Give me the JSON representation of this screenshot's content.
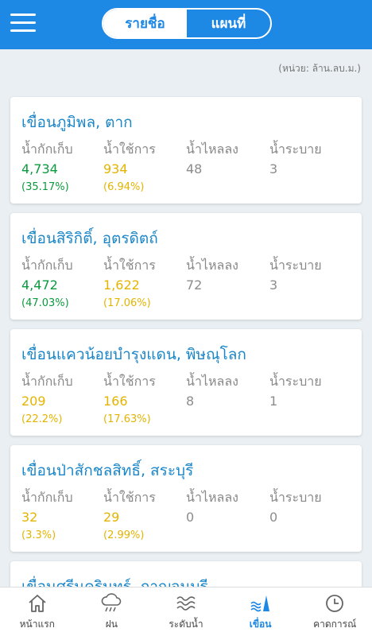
{
  "header": {
    "tabs": [
      "รายชื่อ",
      "แผนที่"
    ],
    "active_tab": "รายชื่อ"
  },
  "unit_note": "(หน่วย: ล้าน.ลบ.ม.)",
  "column_labels": [
    "น้ำกักเก็บ",
    "น้ำใช้การ",
    "น้ำไหลลง",
    "น้ำระบาย"
  ],
  "dams": [
    {
      "name": "เขื่อนภูมิพล, ตาก",
      "storage": "4,734",
      "storage_pct": "(35.17%)",
      "usable": "934",
      "usable_pct": "(6.94%)",
      "inflow": "48",
      "outflow": "3",
      "storage_color": "green",
      "usable_color": "yellow"
    },
    {
      "name": "เขื่อนสิริกิติ์, อุตรดิตถ์",
      "storage": "4,472",
      "storage_pct": "(47.03%)",
      "usable": "1,622",
      "usable_pct": "(17.06%)",
      "inflow": "72",
      "outflow": "3",
      "storage_color": "green",
      "usable_color": "yellow"
    },
    {
      "name": "เขื่อนแควน้อยบำรุงแดน, พิษณุโลก",
      "storage": "209",
      "storage_pct": "(22.2%)",
      "usable": "166",
      "usable_pct": "(17.63%)",
      "inflow": "8",
      "outflow": "1",
      "storage_color": "yellow",
      "usable_color": "yellow"
    },
    {
      "name": "เขื่อนป่าสักชลสิทธิ์, สระบุรี",
      "storage": "32",
      "storage_pct": "(3.3%)",
      "usable": "29",
      "usable_pct": "(2.99%)",
      "inflow": "0",
      "outflow": "0",
      "storage_color": "yellow",
      "usable_color": "yellow"
    },
    {
      "name": "เขื่อนศรีนครินทร์, กาญจนบุรี",
      "storage": "",
      "storage_pct": "",
      "usable": "",
      "usable_pct": "",
      "inflow": "",
      "outflow": "",
      "storage_color": "green",
      "usable_color": "yellow"
    }
  ],
  "bottom_nav": [
    {
      "label": "หน้าแรก",
      "icon": "home-icon"
    },
    {
      "label": "ฝน",
      "icon": "rain-cloud-icon"
    },
    {
      "label": "ระดับน้ำ",
      "icon": "water-level-icon"
    },
    {
      "label": "เขื่อน",
      "icon": "dam-icon"
    },
    {
      "label": "คาดการณ์",
      "icon": "clock-icon"
    }
  ],
  "active_nav": "เขื่อน",
  "colors": {
    "primary": "#1e88e5",
    "green": "#0b9a3e",
    "yellow": "#e3b400",
    "grey": "#8c8c8c",
    "dam_name": "#1a86c8"
  }
}
